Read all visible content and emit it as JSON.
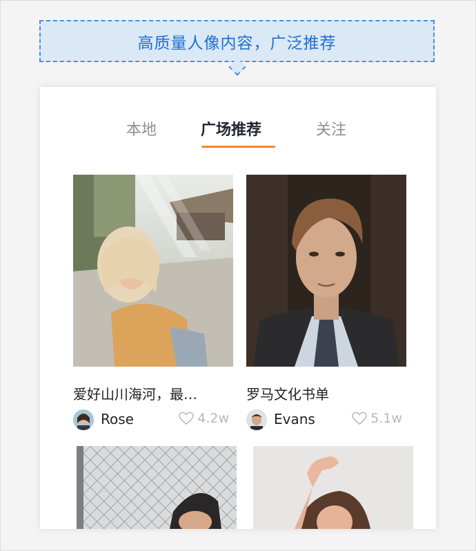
{
  "callout": {
    "text": "高质量人像内容，广泛推荐"
  },
  "tabs": [
    {
      "label": "本地",
      "active": false
    },
    {
      "label": "广场推荐",
      "active": true
    },
    {
      "label": "关注",
      "active": false
    }
  ],
  "accent_color": "#f08a24",
  "posts": [
    {
      "title": "爱好山川海河，最…",
      "user": "Rose",
      "likes": "4.2w"
    },
    {
      "title": "罗马文化书单",
      "user": "Evans",
      "likes": "5.1w"
    }
  ]
}
